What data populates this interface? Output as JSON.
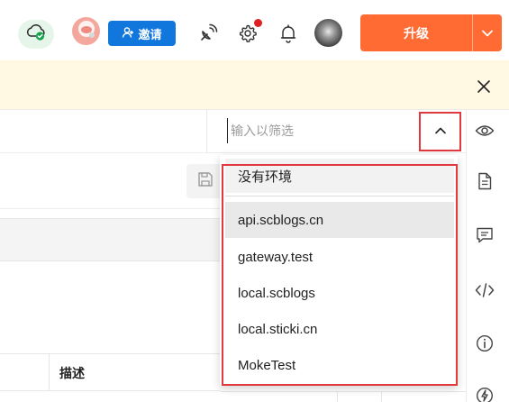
{
  "header": {
    "invite_label": "邀请",
    "upgrade_label": "升级"
  },
  "filter": {
    "placeholder": "输入以筛选"
  },
  "environment_dropdown": {
    "no_environment_label": "没有环境",
    "items": [
      {
        "label": "api.scblogs.cn",
        "selected": true
      },
      {
        "label": "gateway.test",
        "selected": false
      },
      {
        "label": "local.scblogs",
        "selected": false
      },
      {
        "label": "local.sticki.cn",
        "selected": false
      },
      {
        "label": "MokeTest",
        "selected": false
      }
    ]
  },
  "table": {
    "column_description": "描述"
  },
  "right_sidebar": {
    "icons": [
      "eye-icon",
      "document-icon",
      "comment-icon",
      "code-icon",
      "info-icon",
      "lightning-icon"
    ]
  },
  "colors": {
    "upgrade_orange": "#ff6b33",
    "invite_blue": "#1177dd",
    "highlight_red": "#e0393e",
    "banner_yellow": "#fff8e3",
    "cloud_green": "#17a34a"
  }
}
